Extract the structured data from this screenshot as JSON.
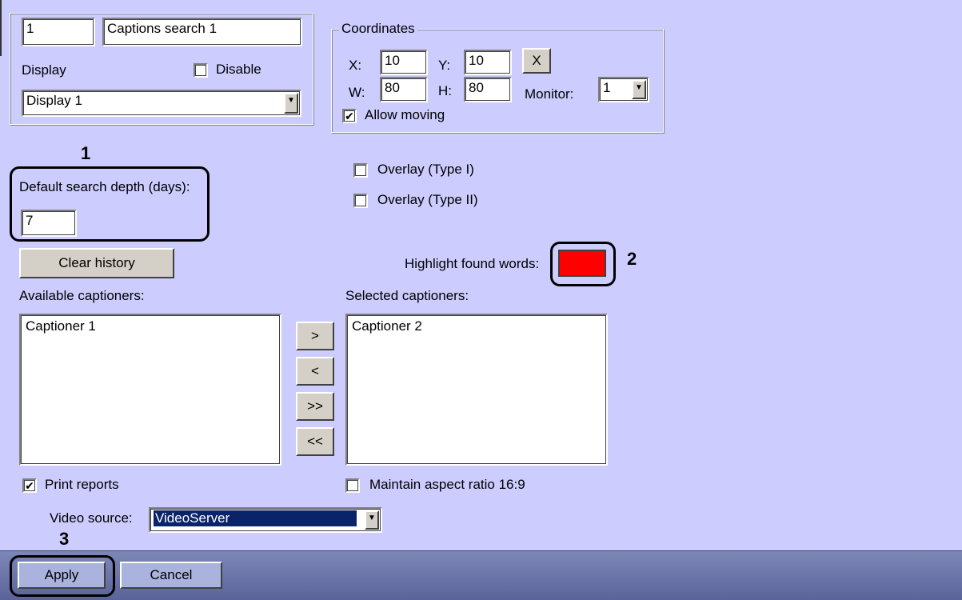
{
  "top_panel": {
    "id_value": "1",
    "name_value": "Captions search 1",
    "display_label": "Display",
    "disable_label": "Disable",
    "disable_checked": false,
    "display_value": "Display 1"
  },
  "coordinates": {
    "title": "Coordinates",
    "x_label": "X:",
    "x_value": "10",
    "y_label": "Y:",
    "y_value": "10",
    "w_label": "W:",
    "w_value": "80",
    "h_label": "H:",
    "h_value": "80",
    "reset_label": "X",
    "monitor_label": "Monitor:",
    "monitor_value": "1",
    "allow_moving_label": "Allow moving",
    "allow_moving_checked": true
  },
  "search": {
    "depth_label": "Default search depth (days):",
    "depth_value": "7",
    "clear_history_label": "Clear history"
  },
  "overlays": {
    "type1_label": "Overlay (Type I)",
    "type2_label": "Overlay (Type II)"
  },
  "highlight": {
    "label": "Highlight found words:",
    "color": "#ff0000"
  },
  "captioners": {
    "available_label": "Available captioners:",
    "selected_label": "Selected captioners:",
    "available_items": [
      "Captioner 1"
    ],
    "selected_items": [
      "Captioner 2"
    ],
    "move_right": ">",
    "move_left": "<",
    "move_all_right": ">>",
    "move_all_left": "<<"
  },
  "options": {
    "print_reports_label": "Print reports",
    "print_reports_checked": true,
    "aspect_label": "Maintain aspect ratio 16:9",
    "aspect_checked": false,
    "video_source_label": "Video source:",
    "video_source_value": "VideoServer"
  },
  "footer": {
    "apply_label": "Apply",
    "cancel_label": "Cancel"
  },
  "callouts": {
    "one": "1",
    "two": "2",
    "three": "3"
  }
}
